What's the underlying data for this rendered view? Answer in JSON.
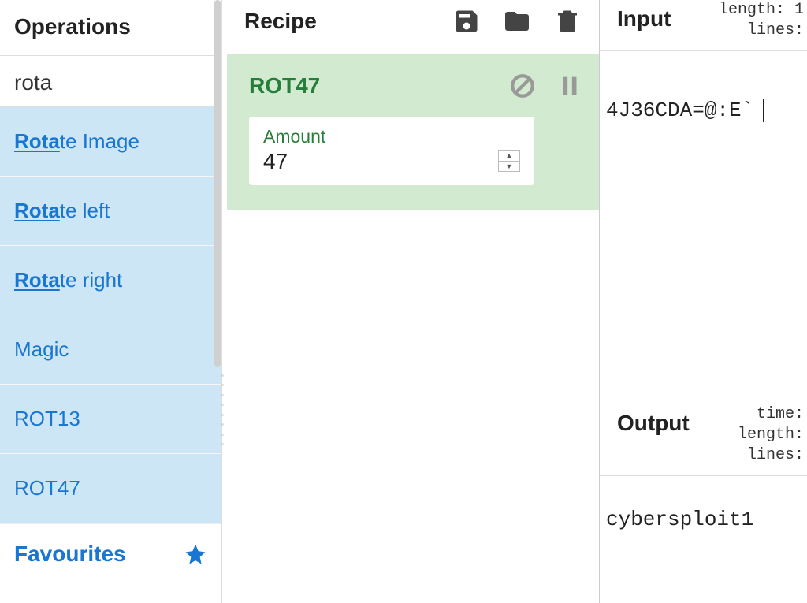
{
  "operations": {
    "title": "Operations",
    "search": "rota",
    "items": [
      {
        "pre": "Rota",
        "rest": "te Image",
        "matched": true
      },
      {
        "pre": "Rota",
        "rest": "te left",
        "matched": true
      },
      {
        "pre": "Rota",
        "rest": "te right",
        "matched": true
      },
      {
        "pre": "",
        "rest": "Magic",
        "matched": false
      },
      {
        "pre": "",
        "rest": "ROT13",
        "matched": false
      },
      {
        "pre": "",
        "rest": "ROT47",
        "matched": false
      }
    ],
    "favourites": "Favourites"
  },
  "recipe": {
    "title": "Recipe",
    "op": {
      "name": "ROT47",
      "arg_label": "Amount",
      "arg_value": "47"
    }
  },
  "input": {
    "title": "Input",
    "stats": "length: 1\n lines:",
    "text": "4J36CDA=@:E`"
  },
  "output": {
    "title": "Output",
    "stats": "  time:\nlength:\n lines:",
    "text": "cybersploit1"
  }
}
